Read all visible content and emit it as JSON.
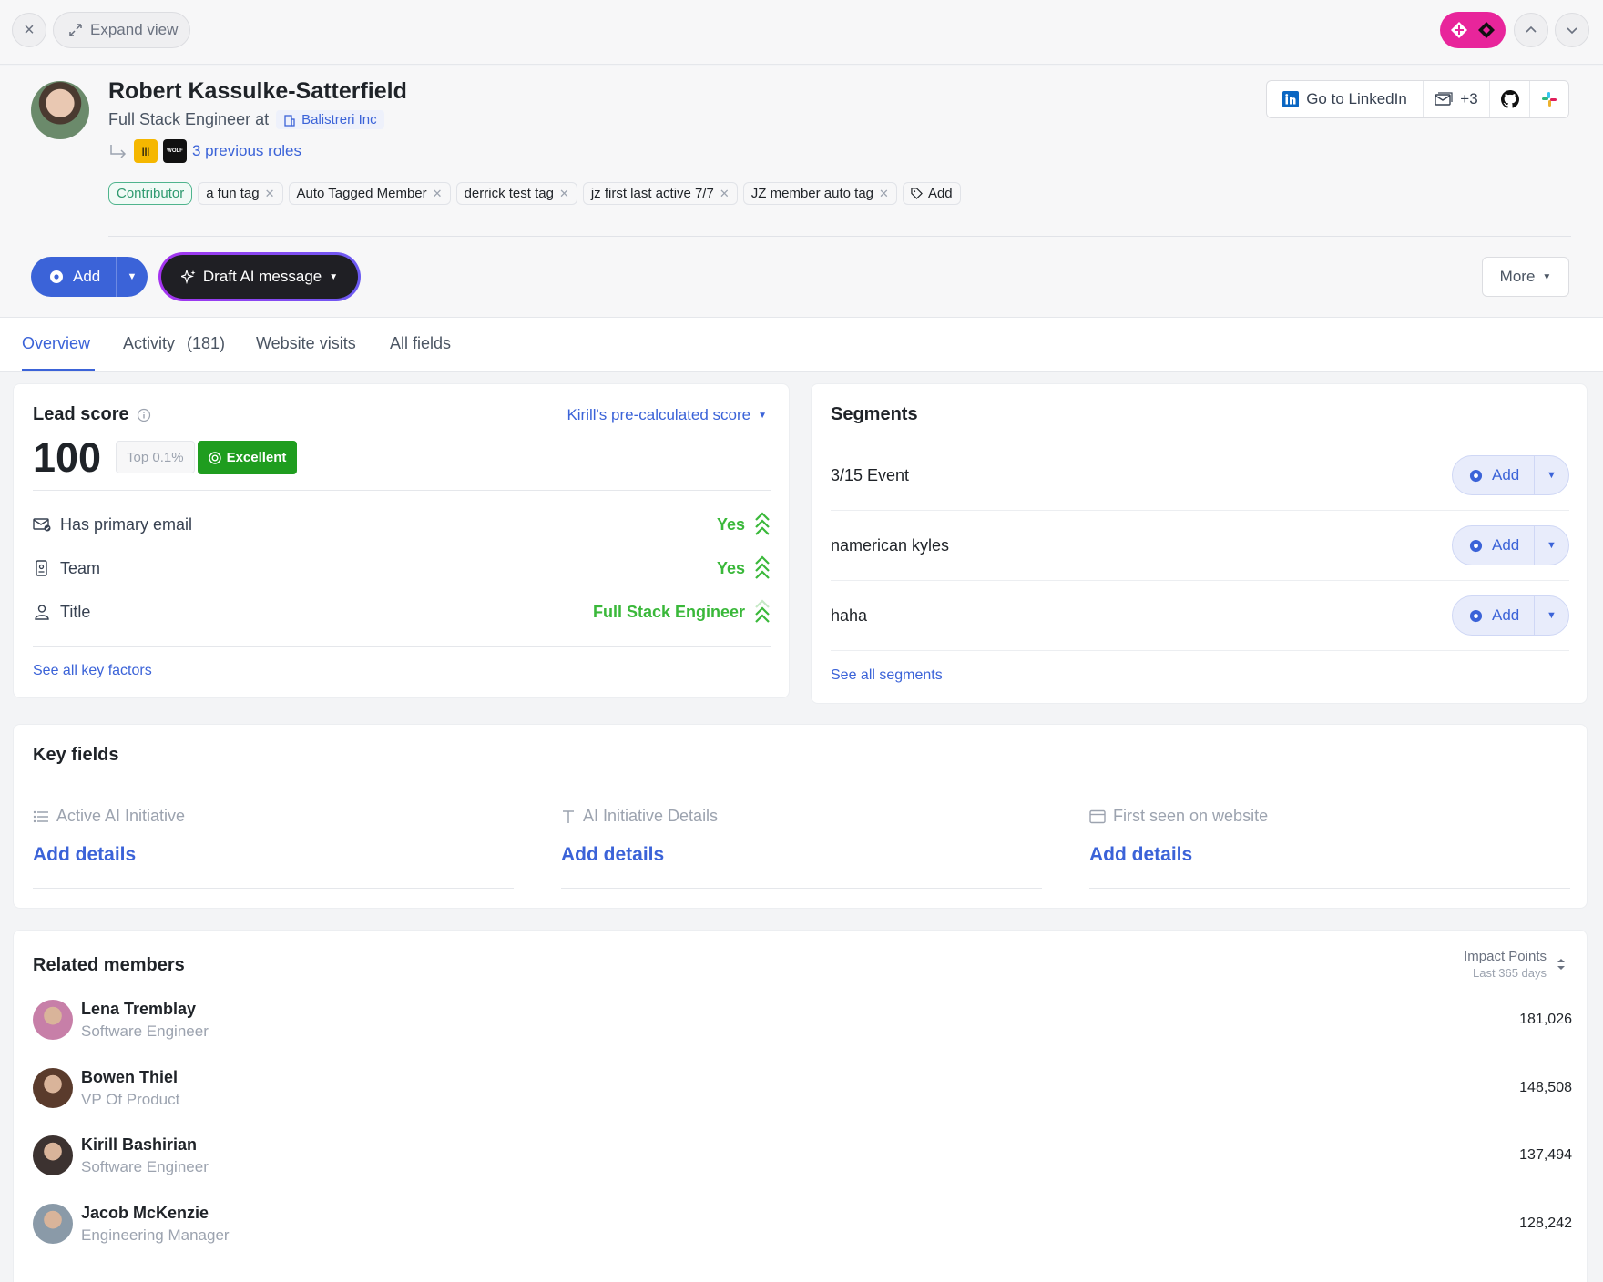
{
  "topbar": {
    "expand_label": "Expand view"
  },
  "profile": {
    "name": "Robert Kassulke-Satterfield",
    "title_prefix": "Full Stack Engineer at",
    "company": "Balistreri Inc",
    "previous_roles": "3 previous roles",
    "tags": [
      {
        "label": "Contributor",
        "removable": false
      },
      {
        "label": "a fun tag",
        "removable": true
      },
      {
        "label": "Auto Tagged Member",
        "removable": true
      },
      {
        "label": "derrick test tag",
        "removable": true
      },
      {
        "label": "jz first last active 7/7",
        "removable": true
      },
      {
        "label": "JZ member auto tag",
        "removable": true
      }
    ],
    "add_tag_label": "Add",
    "linkedin_label": "Go to LinkedIn",
    "email_count": "+3"
  },
  "actions": {
    "add_label": "Add",
    "draft_label": "Draft AI message",
    "more_label": "More"
  },
  "tabs": [
    {
      "label": "Overview",
      "active": true
    },
    {
      "label": "Activity",
      "count": "(181)"
    },
    {
      "label": "Website visits"
    },
    {
      "label": "All fields"
    }
  ],
  "lead_score": {
    "title": "Lead score",
    "model": "Kirill's pre-calculated score",
    "score": "100",
    "rank": "Top 0.1%",
    "grade": "Excellent",
    "factors": [
      {
        "label": "Has primary email",
        "value": "Yes",
        "icon": "mail-check-icon"
      },
      {
        "label": "Team",
        "value": "Yes",
        "icon": "badge-icon"
      },
      {
        "label": "Title",
        "value": "Full Stack Engineer",
        "icon": "user-icon"
      }
    ],
    "see_all": "See all key factors"
  },
  "segments": {
    "title": "Segments",
    "items": [
      {
        "label": "3/15 Event",
        "add_label": "Add"
      },
      {
        "label": "namerican kyles",
        "add_label": "Add"
      },
      {
        "label": "haha",
        "add_label": "Add"
      }
    ],
    "see_all": "See all segments"
  },
  "key_fields": {
    "title": "Key fields",
    "fields": [
      {
        "label": "Active AI Initiative",
        "action": "Add details",
        "icon": "list-icon"
      },
      {
        "label": "AI Initiative Details",
        "action": "Add details",
        "icon": "text-icon"
      },
      {
        "label": "First seen on website",
        "action": "Add details",
        "icon": "browser-icon"
      }
    ]
  },
  "related_members": {
    "title": "Related members",
    "sort_label": "Impact Points",
    "sort_sub": "Last 365 days",
    "members": [
      {
        "name": "Lena Tremblay",
        "role": "Software Engineer",
        "points": "181,026",
        "color": "#c77fa8"
      },
      {
        "name": "Bowen Thiel",
        "role": "VP Of Product",
        "points": "148,508",
        "color": "#5a3b2c"
      },
      {
        "name": "Kirill Bashirian",
        "role": "Software Engineer",
        "points": "137,494",
        "color": "#3c3230"
      },
      {
        "name": "Jacob McKenzie",
        "role": "Engineering Manager",
        "points": "128,242",
        "color": "#8a9aa8"
      }
    ]
  },
  "colors": {
    "accent": "#3b63d8",
    "success": "#3ab83a",
    "excellent_badge": "#1f9d1f",
    "brand_pink": "#e8259b"
  }
}
